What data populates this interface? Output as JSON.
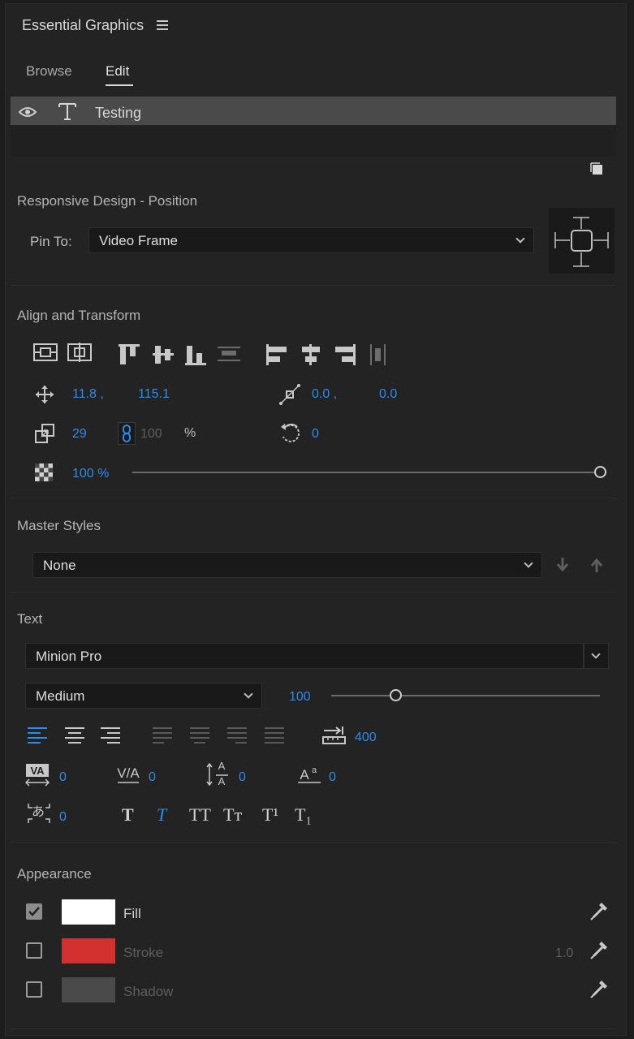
{
  "panel": {
    "title": "Essential Graphics"
  },
  "tabs": [
    {
      "label": "Browse"
    },
    {
      "label": "Edit"
    }
  ],
  "layer": {
    "name": "Testing"
  },
  "responsive": {
    "heading": "Responsive Design - Position",
    "pin_label": "Pin To:",
    "pin_value": "Video Frame"
  },
  "align": {
    "heading": "Align and Transform",
    "position_x": "11.8 ,",
    "position_y": "115.1",
    "anchor_x": "0.0 ,",
    "anchor_y": "0.0",
    "scale": "29",
    "scale_linked": "100",
    "scale_unit": "%",
    "rotation": "0",
    "opacity": "100 %",
    "opacity_level": 1.0
  },
  "master_styles": {
    "heading": "Master Styles",
    "value": "None"
  },
  "text": {
    "heading": "Text",
    "font": "Minion Pro",
    "style": "Medium",
    "size": "100",
    "size_level": 0.24,
    "tab_width": "400",
    "kerning": "0",
    "tracking": "0",
    "leading": "0",
    "baseline_shift": "0",
    "tsume": "0",
    "style_buttons": [
      "T",
      "T",
      "TT",
      "Tт",
      "T¹",
      "T₁"
    ]
  },
  "appearance": {
    "heading": "Appearance",
    "fill_label": "Fill",
    "stroke_label": "Stroke",
    "stroke_width": "1.0",
    "shadow_label": "Shadow",
    "fill_color": "#ffffff",
    "stroke_color": "#d33030",
    "shadow_color": "#4a4a4a"
  },
  "colors": {
    "accent": "#2d8ceb",
    "panel_bg": "#232323",
    "selected_row": "#4a4a4a"
  }
}
